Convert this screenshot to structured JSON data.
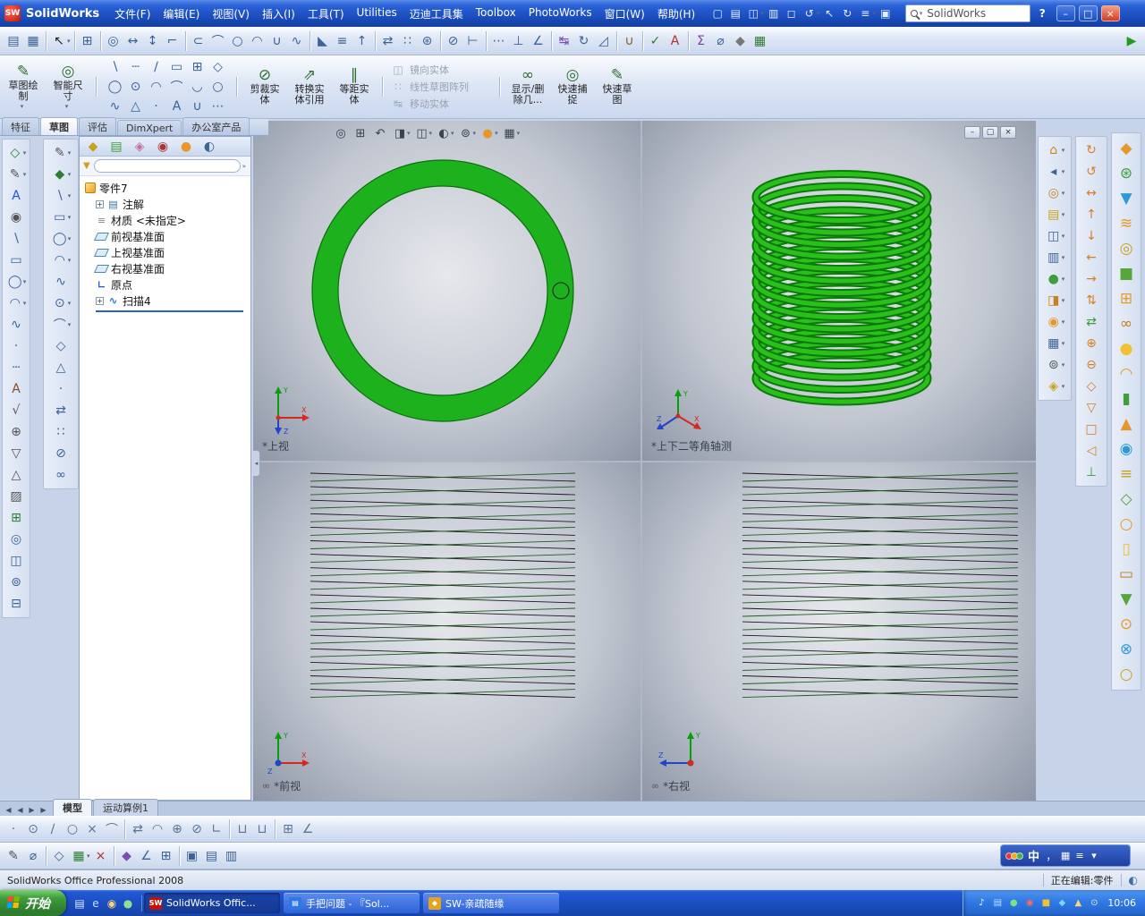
{
  "ui": {
    "dd": "▾",
    "more": "»",
    "plus": "+",
    "min": "–",
    "max": "□",
    "restore": "▢",
    "close": "×",
    "help": "?",
    "axis_x": "X",
    "axis_y": "Y",
    "axis_z": "Z",
    "collapse": "◂"
  },
  "window": {
    "logo_badge": "SW",
    "app_title": "SolidWorks",
    "menus": [
      "文件(F)",
      "编辑(E)",
      "视图(V)",
      "插入(I)",
      "工具(T)",
      "Utilities",
      "迈迪工具集",
      "Toolbox",
      "PhotoWorks",
      "窗口(W)",
      "帮助(H)"
    ],
    "search_value": "SolidWorks"
  },
  "titlebar_icons": [
    {
      "n": "new-document",
      "g": "▢"
    },
    {
      "n": "open",
      "g": "▤"
    },
    {
      "n": "save",
      "g": "◫",
      "dd": true
    },
    {
      "n": "print",
      "g": "▥"
    },
    {
      "n": "print-preview",
      "g": "◻"
    },
    {
      "n": "undo",
      "g": "↺",
      "dd": true
    },
    {
      "n": "select",
      "g": "↖"
    },
    {
      "n": "rebuild",
      "g": "↻"
    },
    {
      "n": "options",
      "g": "≡",
      "dd": true
    },
    {
      "n": "help-book",
      "g": "▣"
    }
  ],
  "main_toolbar": [
    {
      "n": "sheet",
      "g": "▤"
    },
    {
      "n": "drafting-grid",
      "g": "▦"
    },
    {
      "sep": true
    },
    {
      "n": "select",
      "g": "↖",
      "c": "#222",
      "dd": true
    },
    {
      "sep": true
    },
    {
      "n": "grid-system",
      "g": "⊞"
    },
    {
      "sep": true
    },
    {
      "n": "smart-dimension",
      "g": "◎"
    },
    {
      "n": "horizontal-dimension",
      "g": "↔"
    },
    {
      "n": "vertical-dimension",
      "g": "↕"
    },
    {
      "n": "ordinate-dimension",
      "g": "⌐"
    },
    {
      "sep": true
    },
    {
      "n": "straight-slot",
      "g": "⊂"
    },
    {
      "n": "arc-slot",
      "g": "⌒"
    },
    {
      "n": "ellipse",
      "g": "○"
    },
    {
      "n": "partial-ellipse",
      "g": "◠"
    },
    {
      "n": "parabola",
      "g": "∪"
    },
    {
      "n": "spline",
      "g": "∿"
    },
    {
      "sep": true
    },
    {
      "n": "sketch-fillet",
      "g": "◣"
    },
    {
      "n": "offset-entities",
      "g": "≡"
    },
    {
      "n": "convert-entities",
      "g": "↑"
    },
    {
      "sep": true
    },
    {
      "n": "mirror-entities",
      "g": "⇄"
    },
    {
      "n": "linear-pattern",
      "g": "∷"
    },
    {
      "n": "circular-pattern",
      "g": "⊛"
    },
    {
      "sep": true
    },
    {
      "n": "trim-entities",
      "g": "⊘"
    },
    {
      "n": "extend-entities",
      "g": "⊢"
    },
    {
      "sep": true
    },
    {
      "n": "construction-geometry",
      "g": "⋯"
    },
    {
      "n": "add-relation",
      "g": "⊥"
    },
    {
      "n": "angle",
      "g": "∠"
    },
    {
      "sep": true
    },
    {
      "n": "move-entities",
      "g": "↹",
      "c": "#7A4FAF"
    },
    {
      "n": "rotate-entities",
      "g": "↻"
    },
    {
      "n": "scale-entities",
      "g": "◿"
    },
    {
      "sep": true
    },
    {
      "n": "quick-snaps",
      "g": "∪",
      "c": "#8A5A2A"
    },
    {
      "sep": true
    },
    {
      "n": "spell-checker",
      "g": "✓",
      "c": "#2E7D32"
    },
    {
      "n": "abc-note",
      "g": "A",
      "c": "#B03030"
    },
    {
      "sep": true
    },
    {
      "n": "equations",
      "g": "Σ",
      "c": "#7A3FA0"
    },
    {
      "n": "measure",
      "g": "⌀"
    },
    {
      "n": "mass-properties",
      "g": "◆",
      "c": "#777777"
    },
    {
      "n": "design-table",
      "g": "▦",
      "c": "#2E7D32"
    },
    {
      "sp": true
    },
    {
      "n": "play",
      "g": "▶",
      "c": "#1E9E1E"
    }
  ],
  "sketch_bar": {
    "sketch_btn": {
      "label": "草图绘制",
      "glyph": "✎"
    },
    "smart_dim_btn": {
      "label": "智能尺寸",
      "glyph": "◎"
    },
    "entity_icons": [
      {
        "n": "line",
        "g": "∖"
      },
      {
        "n": "centerline",
        "g": "┄"
      },
      {
        "n": "midpoint-line",
        "g": "∕"
      },
      {
        "n": "corner-rectangle",
        "g": "▭"
      },
      {
        "n": "center-rectangle",
        "g": "⊞"
      },
      {
        "n": "3point-rectangle",
        "g": "◇"
      },
      {
        "n": "circle",
        "g": "◯"
      },
      {
        "n": "perimeter-circle",
        "g": "⊙"
      },
      {
        "n": "centerpoint-arc",
        "g": "◠"
      },
      {
        "n": "tangent-arc",
        "g": "⌒"
      },
      {
        "n": "3point-arc",
        "g": "◡"
      },
      {
        "n": "ellipse",
        "g": "○"
      },
      {
        "n": "spline",
        "g": "∿"
      },
      {
        "n": "polygon",
        "g": "△"
      },
      {
        "n": "point",
        "g": "·"
      },
      {
        "n": "sketch-text",
        "g": "A"
      },
      {
        "n": "parabola",
        "g": "∪"
      },
      {
        "n": "construction-line",
        "g": "⋯"
      }
    ],
    "tools": [
      {
        "label": "剪裁实体",
        "glyph": "⊘"
      },
      {
        "label": "转换实体引用",
        "glyph": "⇗"
      },
      {
        "label": "等距实体",
        "glyph": "∥"
      }
    ],
    "disabled_tools": [
      {
        "label": "镜向实体",
        "glyph": "◫"
      },
      {
        "label": "线性草图阵列",
        "glyph": "∷"
      },
      {
        "label": "移动实体",
        "glyph": "↹"
      }
    ],
    "right_tools": [
      {
        "label": "显示/删除几...",
        "glyph": "∞"
      },
      {
        "label": "快速捕捉",
        "glyph": "◎"
      },
      {
        "label": "快速草图",
        "glyph": "✎"
      }
    ]
  },
  "command_manager": {
    "tabs": [
      "特征",
      "草图",
      "评估",
      "DimXpert",
      "办公室产品"
    ],
    "active_index": 1
  },
  "left_strip_1": [
    {
      "n": "sketch-entity",
      "g": "◇",
      "c": "#2E7D32",
      "dd": true
    },
    {
      "n": "dimension",
      "g": "✎",
      "c": "#555555",
      "dd": true
    },
    {
      "n": "note",
      "g": "A",
      "c": "#2255CC"
    },
    {
      "n": "balloon",
      "g": "◉",
      "c": "#555555"
    },
    {
      "n": "line",
      "g": "∖"
    },
    {
      "n": "rectangle",
      "g": "▭"
    },
    {
      "n": "circle",
      "g": "◯",
      "dd": true
    },
    {
      "n": "arc",
      "g": "◠",
      "dd": true
    },
    {
      "n": "spline",
      "g": "∿"
    },
    {
      "n": "point",
      "g": "·"
    },
    {
      "n": "centerline",
      "g": "┄"
    },
    {
      "n": "text",
      "g": "A",
      "c": "#8A4A2A"
    },
    {
      "n": "surface-finish",
      "g": "√",
      "c": "#555555"
    },
    {
      "n": "geometric-tolerance",
      "g": "⊕",
      "c": "#555555"
    },
    {
      "n": "datum",
      "g": "▽",
      "c": "#555555"
    },
    {
      "n": "weld-symbol",
      "g": "△",
      "c": "#555555"
    },
    {
      "n": "hatch",
      "g": "▨",
      "c": "#555555"
    },
    {
      "n": "table",
      "g": "⊞",
      "c": "#2E7D32"
    },
    {
      "n": "view",
      "g": "◎"
    },
    {
      "n": "section",
      "g": "◫"
    },
    {
      "n": "detail",
      "g": "⊚"
    },
    {
      "n": "crop",
      "g": "⊟"
    }
  ],
  "left_strip_2": [
    {
      "n": "smart-dimension",
      "g": "✎",
      "c": "#555555",
      "dd": true
    },
    {
      "n": "sketch",
      "g": "◆",
      "c": "#2E7D32",
      "dd": true
    },
    {
      "n": "line",
      "g": "∖",
      "dd": true
    },
    {
      "n": "corner-rectangle",
      "g": "▭",
      "dd": true
    },
    {
      "n": "circle",
      "g": "◯",
      "dd": true
    },
    {
      "n": "centerpoint-arc",
      "g": "◠",
      "dd": true
    },
    {
      "n": "spline",
      "g": "∿"
    },
    {
      "n": "ellipse",
      "g": "⊙",
      "dd": true
    },
    {
      "n": "sketch-fillet",
      "g": "⌒",
      "dd": true
    },
    {
      "n": "plane",
      "g": "◇"
    },
    {
      "n": "polygon",
      "g": "△"
    },
    {
      "n": "point",
      "g": "·"
    },
    {
      "n": "mirror-entities",
      "g": "⇄"
    },
    {
      "n": "linear-pattern",
      "g": "∷"
    },
    {
      "n": "trim-entities",
      "g": "⊘"
    },
    {
      "n": "display-relations",
      "g": "∞"
    }
  ],
  "right_strip_a": [
    {
      "n": "view-orientation",
      "g": "⌂",
      "c": "#C8821E",
      "dd": true
    },
    {
      "n": "previous-view",
      "g": "◂",
      "dd": true
    },
    {
      "n": "zoom-to-fit",
      "g": "◎",
      "c": "#C8821E",
      "dd": true
    },
    {
      "n": "open-part",
      "g": "▤",
      "c": "#C8A21E",
      "dd": true
    },
    {
      "n": "standard-views",
      "g": "◫",
      "dd": true
    },
    {
      "n": "wireframe",
      "g": "▥",
      "dd": true
    },
    {
      "n": "shaded",
      "g": "●",
      "c": "#3C9E3C",
      "dd": true
    },
    {
      "n": "section-view",
      "g": "◨",
      "c": "#C8821E",
      "dd": true
    },
    {
      "n": "appearance",
      "g": "◉",
      "c": "#E8972A",
      "dd": true
    },
    {
      "n": "scene",
      "g": "▦",
      "dd": true
    },
    {
      "n": "camera",
      "g": "⊚",
      "c": "#555555",
      "dd": true
    },
    {
      "n": "lights",
      "g": "◈",
      "c": "#C8A21E",
      "dd": true
    }
  ],
  "right_strip_b": [
    {
      "n": "rotate-view",
      "g": "↻",
      "c": "#D97E1F"
    },
    {
      "n": "rotate-back",
      "g": "↺",
      "c": "#D97E1F"
    },
    {
      "n": "pan",
      "g": "↔",
      "c": "#D97E1F"
    },
    {
      "n": "up",
      "g": "↑",
      "c": "#D97E1F"
    },
    {
      "n": "down",
      "g": "↓",
      "c": "#D97E1F"
    },
    {
      "n": "left",
      "g": "←",
      "c": "#D97E1F"
    },
    {
      "n": "right",
      "g": "→",
      "c": "#D97E1F"
    },
    {
      "n": "flip",
      "g": "⇅",
      "c": "#D97E1F"
    },
    {
      "n": "swap",
      "g": "⇄",
      "c": "#3C9E3C"
    },
    {
      "n": "zoom-in",
      "g": "⊕",
      "c": "#D97E1F"
    },
    {
      "n": "zoom-out",
      "g": "⊖",
      "c": "#D97E1F"
    },
    {
      "n": "isometric-view",
      "g": "◇",
      "c": "#D97E1F"
    },
    {
      "n": "top-view",
      "g": "▽",
      "c": "#D97E1F"
    },
    {
      "n": "front-view",
      "g": "□",
      "c": "#D97E1F"
    },
    {
      "n": "side-view",
      "g": "◁",
      "c": "#D97E1F"
    },
    {
      "n": "normal-to",
      "g": "⊥",
      "c": "#3C9E3C"
    }
  ],
  "right_strip_c": [
    {
      "n": "madi-part-library",
      "g": "◆",
      "c": "#E8972A",
      "cls": "big"
    },
    {
      "n": "madi-gear",
      "g": "⊛",
      "c": "#3C9E3C",
      "cls": "big"
    },
    {
      "n": "madi-bolt",
      "g": "▼",
      "c": "#2E9BD6",
      "cls": "big"
    },
    {
      "n": "madi-spring",
      "g": "≋",
      "c": "#E8972A",
      "cls": "big"
    },
    {
      "n": "madi-bearing",
      "g": "◎",
      "c": "#C8A21E",
      "cls": "big"
    },
    {
      "n": "madi-motor",
      "g": "■",
      "c": "#57A639",
      "cls": "big"
    },
    {
      "n": "madi-frame",
      "g": "⊞",
      "c": "#E8972A",
      "cls": "big"
    },
    {
      "n": "madi-chain",
      "g": "∞",
      "c": "#C87A1E",
      "cls": "big"
    },
    {
      "n": "madi-cam",
      "g": "●",
      "c": "#F2C12E",
      "cls": "big"
    },
    {
      "n": "madi-belt",
      "g": "◠",
      "c": "#E8972A",
      "cls": "big"
    },
    {
      "n": "madi-cylinder",
      "g": "▮",
      "c": "#3C9E3C",
      "cls": "big"
    },
    {
      "n": "madi-valve",
      "g": "▲",
      "c": "#E8972A",
      "cls": "big"
    },
    {
      "n": "madi-pump",
      "g": "◉",
      "c": "#2E9BD6",
      "cls": "big"
    },
    {
      "n": "madi-screw",
      "g": "≡",
      "c": "#C8A21E",
      "cls": "big"
    },
    {
      "n": "madi-nut",
      "g": "◇",
      "c": "#57A639",
      "cls": "big"
    },
    {
      "n": "madi-washer",
      "g": "○",
      "c": "#E8972A",
      "cls": "big"
    },
    {
      "n": "madi-pin",
      "g": "▯",
      "c": "#F2C12E",
      "cls": "big"
    },
    {
      "n": "madi-key",
      "g": "▭",
      "c": "#C87A1E",
      "cls": "big"
    },
    {
      "n": "madi-rivet",
      "g": "▼",
      "c": "#57A639",
      "cls": "big"
    },
    {
      "n": "madi-flange",
      "g": "⊙",
      "c": "#E8972A",
      "cls": "big"
    },
    {
      "n": "madi-coupling",
      "g": "⊗",
      "c": "#2E9BD6",
      "cls": "big"
    },
    {
      "n": "madi-seal",
      "g": "○",
      "c": "#C8A21E",
      "cls": "big"
    }
  ],
  "feature_panel": {
    "header_icons": [
      {
        "n": "featuremanager",
        "g": "◆",
        "c": "#C8A020"
      },
      {
        "n": "propertymanager",
        "g": "▤",
        "c": "#3C9E3C"
      },
      {
        "n": "configurationmanager",
        "g": "◈",
        "c": "#C86AA0"
      },
      {
        "n": "dimxpertmanager",
        "g": "◉",
        "c": "#B03030"
      },
      {
        "n": "displaymanager",
        "g": "●",
        "c": "#E8972A"
      },
      {
        "n": "appearances-tab",
        "g": "◐",
        "c": "#3C6296"
      }
    ],
    "tree": {
      "items": [
        {
          "label": "零件7"
        },
        {
          "label": "注解",
          "exp": "+",
          "icon_glyph": "▤"
        },
        {
          "label": "材质 <未指定>",
          "icon_glyph": "≡"
        },
        {
          "label": "前视基准面"
        },
        {
          "label": "上视基准面"
        },
        {
          "label": "右视基准面"
        },
        {
          "label": "原点",
          "icon_glyph": "∟"
        },
        {
          "label": "扫描4",
          "exp": "+",
          "icon_glyph": "∿"
        }
      ]
    }
  },
  "headsup_icons": [
    {
      "n": "zoom-to-fit",
      "g": "◎"
    },
    {
      "n": "zoom-to-area",
      "g": "⊞"
    },
    {
      "n": "previous-view",
      "g": "↶"
    },
    {
      "n": "section-view",
      "g": "◨",
      "dd": true
    },
    {
      "n": "view-orientation",
      "g": "◫",
      "dd": true
    },
    {
      "n": "display-style",
      "g": "◐",
      "dd": true
    },
    {
      "n": "hide-show-items",
      "g": "⊚",
      "dd": true
    },
    {
      "n": "edit-appearance",
      "g": "●",
      "c": "#E8972A",
      "dd": true
    },
    {
      "n": "apply-scene",
      "g": "▦",
      "dd": true
    }
  ],
  "viewports": [
    {
      "label": "*上视"
    },
    {
      "label": "*上下二等角轴测"
    },
    {
      "label": "*前视",
      "prefix": "∞"
    },
    {
      "label": "*右视",
      "prefix": "∞"
    }
  ],
  "model": {
    "type": "helical-coil",
    "coils": 16,
    "side_rows": 17,
    "ring_fill": "#1DB21D",
    "ring_edge": "#0A6E0A",
    "stroke_dark": "#0B7A0B",
    "stroke_bright": "#2BBF1C",
    "side_dark": "#1A1A1A",
    "side_green": "#1F5C1F"
  },
  "bottom": {
    "tabs": [
      "模型",
      "运动算例1"
    ],
    "active_index": 0,
    "nav_icons": [
      {
        "n": "first-tab",
        "g": "◀",
        "cls": "nav"
      },
      {
        "n": "previous-tab",
        "g": "◀",
        "cls": "nav"
      },
      {
        "n": "next-tab",
        "g": "▶",
        "cls": "nav"
      },
      {
        "n": "last-tab",
        "g": "▶",
        "cls": "nav"
      }
    ]
  },
  "bottom_strip_1": [
    {
      "n": "point",
      "g": "·"
    },
    {
      "n": "circle-tool",
      "g": "⊙"
    },
    {
      "n": "line-tool",
      "g": "∕"
    },
    {
      "n": "circle2-tool",
      "g": "○"
    },
    {
      "n": "erase-tool",
      "g": "×"
    },
    {
      "n": "arc-tool",
      "g": "⌒"
    },
    {
      "sep": true
    },
    {
      "n": "mirror-tool",
      "g": "⇄"
    },
    {
      "n": "arc2-tool",
      "g": "◠"
    },
    {
      "n": "fillet-tool",
      "g": "⊕"
    },
    {
      "n": "trim-tool",
      "g": "⊘"
    },
    {
      "n": "corner-tool",
      "g": "∟"
    },
    {
      "sep": true
    },
    {
      "n": "slot-tool",
      "g": "⊔"
    },
    {
      "n": "slot2-tool",
      "g": "⊔"
    },
    {
      "sep": true
    },
    {
      "n": "grid-tool",
      "g": "⊞"
    },
    {
      "n": "angle-tool",
      "g": "∠"
    }
  ],
  "bottom_strip_2": [
    {
      "n": "sketch-pencil",
      "g": "✎",
      "c": "#555555"
    },
    {
      "n": "dimension-tool",
      "g": "⌀"
    },
    {
      "sep": true
    },
    {
      "n": "plane-tool",
      "g": "◇"
    },
    {
      "n": "design-table-tool",
      "g": "▦",
      "c": "#2E7D32",
      "dd": true
    },
    {
      "n": "delete-tool",
      "g": "×",
      "c": "#B03030"
    },
    {
      "sep": true
    },
    {
      "n": "3d-sketch-tool",
      "g": "◆",
      "c": "#7A4FAF"
    },
    {
      "n": "angle-snap-tool",
      "g": "∠"
    },
    {
      "n": "snap-grid-tool",
      "g": "⊞"
    },
    {
      "sep": true
    },
    {
      "n": "display-box-1",
      "g": "▣"
    },
    {
      "n": "display-box-2",
      "g": "▤"
    },
    {
      "n": "display-box-3",
      "g": "▥"
    }
  ],
  "language_bar": {
    "mode": "中",
    "icons": [
      {
        "n": "ime-punctuation",
        "g": "，",
        "c": "#FFFFFF"
      },
      {
        "n": "ime-keyboard",
        "g": "▦",
        "c": "#FFFFFF"
      },
      {
        "n": "ime-settings",
        "g": "≡",
        "c": "#FFFFFF"
      },
      {
        "n": "ime-expand",
        "g": "▾",
        "c": "#FFFFFF"
      }
    ]
  },
  "status_bar": {
    "left": "SolidWorks Office Professional 2008",
    "editing": "正在编辑:零件"
  },
  "taskbar": {
    "start_label": "开始",
    "quick_launch": [
      {
        "n": "show-desktop",
        "g": "▤",
        "c": "#DDE8FF"
      },
      {
        "n": "internet-explorer",
        "g": "e",
        "c": "#BFE0FF"
      },
      {
        "n": "media-player",
        "g": "◉",
        "c": "#FFD27A"
      },
      {
        "n": "messenger",
        "g": "●",
        "c": "#8FE08F"
      }
    ],
    "tasks": [
      {
        "label": "SolidWorks Offic...",
        "badge": "SW"
      },
      {
        "label": "手把问题 - 『Sol...",
        "badge": "▤"
      },
      {
        "label": "SW-亲疏随缘",
        "badge": "◆"
      }
    ],
    "tray_icons": [
      {
        "n": "volume",
        "g": "♪",
        "c": "#FFFFFF"
      },
      {
        "n": "network",
        "g": "▤",
        "c": "#BFE0FF"
      },
      {
        "n": "antivirus",
        "g": "●",
        "c": "#7FE07F"
      },
      {
        "n": "qq",
        "g": "◉",
        "c": "#FF6A5A"
      },
      {
        "n": "ime-tray",
        "g": "■",
        "c": "#F2C12E"
      },
      {
        "n": "update",
        "g": "◆",
        "c": "#7FD4FF"
      },
      {
        "n": "safety",
        "g": "▲",
        "c": "#FFD27A"
      },
      {
        "n": "scheduler",
        "g": "⊙",
        "c": "#E8E8E8"
      }
    ],
    "time": "10:06"
  }
}
